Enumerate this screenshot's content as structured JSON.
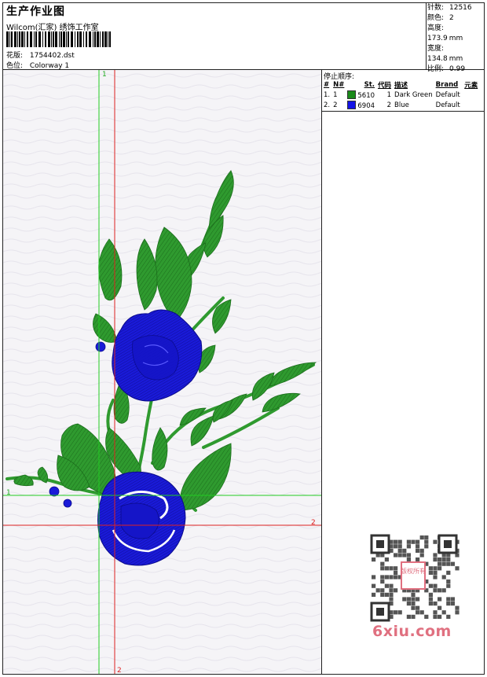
{
  "header": {
    "title": "生产作业图",
    "studio": "Wilcom(汇家) 绣饰工作室",
    "pattern_label": "花版:",
    "pattern_value": "1754402.dst",
    "colorway_label": "色位:",
    "colorway_value": "Colorway 1"
  },
  "stats": {
    "stitches_label": "针数:",
    "stitches_value": "12516",
    "colors_label": "颜色:",
    "colors_value": "2",
    "height_label": "高度:",
    "height_value": "173.9",
    "height_unit": "mm",
    "width_label": "宽度:",
    "width_value": "134.8",
    "width_unit": "mm",
    "scale_label": "比例:",
    "scale_value": "0.99"
  },
  "stop_sequence": {
    "caption": "停止顺序:",
    "columns": [
      "#",
      "N#",
      "St.",
      "代码",
      "描述",
      "Brand",
      "元素"
    ],
    "rows": [
      {
        "idx": "1.",
        "n": "1",
        "swatch": "#1a8a1a",
        "st": "5610",
        "code": "1",
        "desc": "Dark Green",
        "brand": "Default"
      },
      {
        "idx": "2.",
        "n": "2",
        "swatch": "#1414e6",
        "st": "6904",
        "code": "2",
        "desc": "Blue",
        "brand": "Default"
      }
    ]
  },
  "guides": {
    "green_label_top": "1",
    "green_label_left": "1",
    "red_label_right": "2",
    "red_label_bottom": "2",
    "green_color": "#22cc22",
    "red_color": "#dd2222"
  },
  "watermark": {
    "text": "6xiu.com",
    "seal_text": "版权所有"
  },
  "colors": {
    "green": "#2f9a2f",
    "blue": "#1a1ad8",
    "dark_blue": "#0b0b8a"
  }
}
